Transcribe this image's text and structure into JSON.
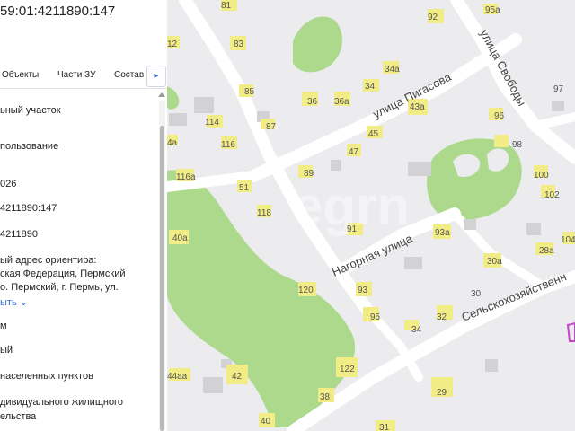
{
  "panel": {
    "cadastral_number": "59:01:4211890:147",
    "tabs": [
      "Объекты",
      "Части ЗУ",
      "Состав"
    ],
    "tab_more_icon": "chevron-right-icon",
    "rows": [
      "ьный участок",
      "пользование",
      "026",
      "4211890:147",
      "4211890",
      "ый адрес ориентира:",
      "ская Федерация, Пермский",
      "о. Пермский, г. Пермь, ул.",
      "м",
      "ый",
      "населенных пунктов",
      "дивидуального жилищного",
      "ельства"
    ],
    "more_link": "ыть",
    "more_icon": "chevron-down-icon"
  },
  "map": {
    "background_color": "#ececef",
    "road_color": "#ffffff",
    "building_color": "#d2d2d5",
    "labeled_building_color": "#f2ec86",
    "forest_color": "#acd98c",
    "parcel_outline_color": "#c445c8",
    "watermark": "egrn",
    "streets": [
      "улица Пигасова",
      "улица Свободы",
      "Нагорная улица",
      "Сельскохозяйственн"
    ],
    "house_numbers": [
      "81",
      "92",
      "95а",
      "12",
      "83",
      "34а",
      "97",
      "85",
      "36",
      "36а",
      "34",
      "43а",
      "96",
      "114",
      "87",
      "45",
      "98",
      "4а",
      "116",
      "47",
      "89",
      "100",
      "116а",
      "51",
      "102",
      "118",
      "91",
      "93а",
      "40а",
      "28а",
      "104",
      "30а",
      "120",
      "93",
      "30",
      "32",
      "95",
      "34",
      "44аа",
      "42",
      "122",
      "38",
      "29",
      "40",
      "31"
    ]
  }
}
